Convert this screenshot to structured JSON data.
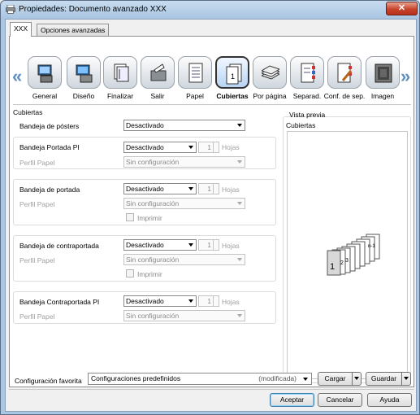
{
  "window": {
    "title": "Propiedades: Documento avanzado XXX",
    "close": "✕"
  },
  "tabs": [
    {
      "label": "XXX",
      "active": true
    },
    {
      "label": "Opciones avanzadas",
      "active": false
    }
  ],
  "toolbar": {
    "prev": "«",
    "next": "»",
    "items": [
      {
        "label": "General",
        "icon": "general-icon"
      },
      {
        "label": "Diseño",
        "icon": "layout-icon"
      },
      {
        "label": "Finalizar",
        "icon": "finishing-icon"
      },
      {
        "label": "Salir",
        "icon": "output-icon"
      },
      {
        "label": "Papel",
        "icon": "paper-icon"
      },
      {
        "label": "Cubiertas",
        "icon": "cover-icon",
        "selected": true
      },
      {
        "label": "Por página",
        "icon": "per-page-icon"
      },
      {
        "label": "Separad.",
        "icon": "separator-icon"
      },
      {
        "label": "Conf. de sep.",
        "icon": "separator-settings-icon"
      },
      {
        "label": "Imagen",
        "icon": "image-icon"
      }
    ]
  },
  "covers": {
    "group_title": "Cubiertas",
    "poster_tray": {
      "label": "Bandeja de pósters",
      "value": "Desactivado"
    },
    "pi_front": {
      "label": "Bandeja Portada PI",
      "value": "Desactivado",
      "count": "1",
      "unit": "Hojas",
      "profile_label": "Perfil Papel",
      "profile_value": "Sin configuración"
    },
    "front": {
      "label": "Bandeja de portada",
      "value": "Desactivado",
      "count": "1",
      "unit": "Hojas",
      "profile_label": "Perfil Papel",
      "profile_value": "Sin configuración",
      "print_label": "Imprimir"
    },
    "back": {
      "label": "Bandeja de contraportada",
      "value": "Desactivado",
      "count": "1",
      "unit": "Hojas",
      "profile_label": "Perfil Papel",
      "profile_value": "Sin configuración",
      "print_label": "Imprimir"
    },
    "pi_back": {
      "label": "Bandeja Contraportada PI",
      "value": "Desactivado",
      "count": "1",
      "unit": "Hojas",
      "profile_label": "Perfil Papel",
      "profile_value": "Sin configuración"
    }
  },
  "preview": {
    "title": "Vista previa",
    "subtitle": "Cubiertas",
    "page_labels": [
      "1",
      "2",
      "3",
      "n-1"
    ]
  },
  "footer": {
    "favorite_label": "Configuración favorita",
    "favorite_value": "Configuraciones predefinidos",
    "favorite_modified": "(modificada)",
    "load": "Cargar",
    "save": "Guardar",
    "ok": "Aceptar",
    "cancel": "Cancelar",
    "help": "Ayuda"
  },
  "colors": {
    "accent": "#5f8fbf",
    "selected_tile": "#b8d4f3",
    "titlebar": "#a9c6e3",
    "close": "#c7442b"
  }
}
